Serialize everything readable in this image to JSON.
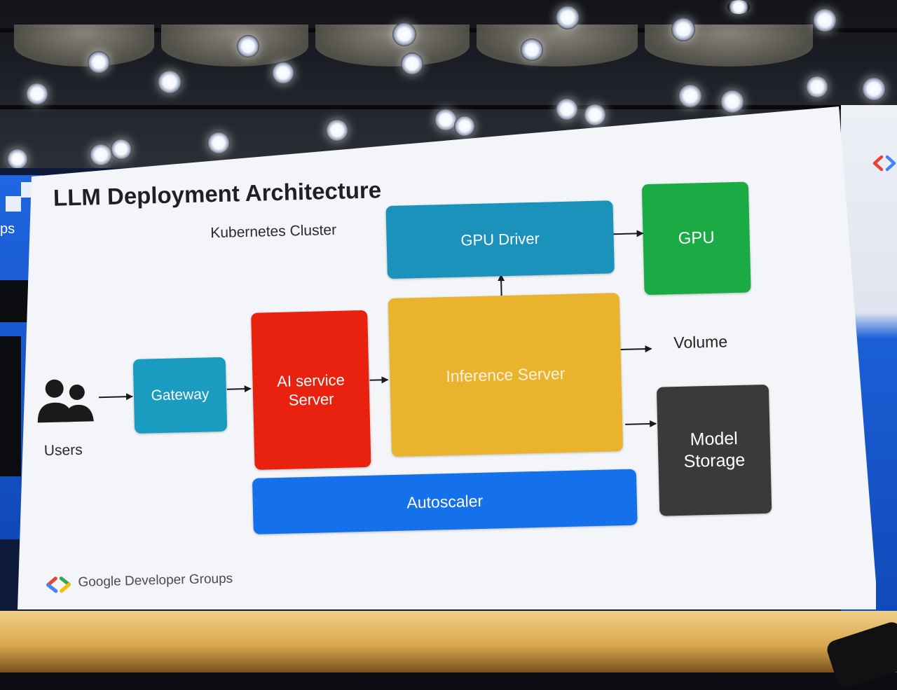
{
  "slide": {
    "title": "LLM Deployment Architecture",
    "cluster_label": "Kubernetes Cluster",
    "footer": "Google Developer Groups",
    "side_fragment": "ps"
  },
  "nodes": {
    "users": "Users",
    "gateway": "Gateway",
    "ai_service_server": "AI service\nServer",
    "inference_server": "Inference Server",
    "gpu_driver": "GPU Driver",
    "gpu": "GPU",
    "volume": "Volume",
    "model_storage": "Model\nStorage",
    "autoscaler": "Autoscaler"
  },
  "colors": {
    "gateway": "#1a9bc0",
    "ai_service_server": "#e8220e",
    "inference_server": "#eab32e",
    "gpu_driver": "#1a92bb",
    "gpu": "#1aab45",
    "model_storage": "#3a3a3a",
    "autoscaler": "#1570ec",
    "logo_blue": "#4285f4",
    "logo_red": "#ea4335",
    "logo_green": "#34a853",
    "logo_yellow": "#fbbc04"
  },
  "edges": [
    {
      "from": "users",
      "to": "gateway"
    },
    {
      "from": "gateway",
      "to": "ai_service_server"
    },
    {
      "from": "ai_service_server",
      "to": "inference_server"
    },
    {
      "from": "inference_server",
      "to": "gpu_driver"
    },
    {
      "from": "gpu_driver",
      "to": "gpu"
    },
    {
      "from": "inference_server",
      "to": "volume"
    },
    {
      "from": "inference_server",
      "to": "model_storage"
    }
  ]
}
